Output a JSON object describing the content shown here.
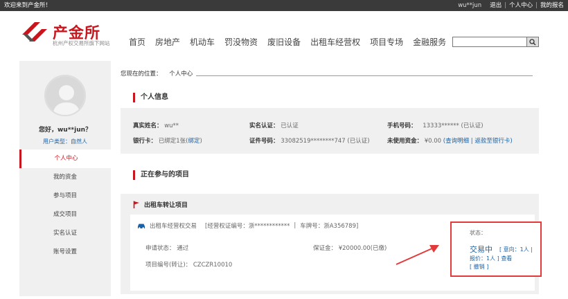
{
  "topbar": {
    "welcome": "欢迎来到产金所！",
    "user": "wu**jun",
    "logout": "退出",
    "center": "个人中心",
    "report": "我的报名"
  },
  "brand": {
    "name": "产金所",
    "sub": "杭州产权交易所旗下网站",
    "color": "#c7161d"
  },
  "nav": [
    "首页",
    "房地产",
    "机动车",
    "罚没物资",
    "废旧设备",
    "出租车经营权",
    "项目专场",
    "金融服务"
  ],
  "search": {
    "placeholder": ""
  },
  "sidebar": {
    "hello": "您好，wu**jun？",
    "user_type": "用户类型：自然人",
    "items": [
      {
        "label": "个人中心",
        "active": true
      },
      {
        "label": "我的资金"
      },
      {
        "label": "参与项目"
      },
      {
        "label": "成交项目"
      },
      {
        "label": "实名认证"
      },
      {
        "label": "账号设置"
      }
    ]
  },
  "breadcrumb": {
    "label": "您现在的位置：",
    "current": "个人中心"
  },
  "personal": {
    "title": "个人信息",
    "name_label": "真实姓名：",
    "name_value": "wu**",
    "verify_label": "实名认证：",
    "verify_value": "已认证",
    "phone_label": "手机号码：",
    "phone_value": "13333******",
    "phone_status": "(已认证)",
    "card_label": "银行卡：",
    "card_value": "已绑定1张(",
    "card_link": "绑定",
    "card_end": ")",
    "id_label": "证件号码：",
    "id_value": "33082519********747",
    "id_status": "(已认证)",
    "funds_label": "未使用资金：",
    "funds_value": "¥0.00",
    "funds_link1": "查询明细",
    "funds_link2": "返款至银行卡"
  },
  "projects": {
    "title": "正在参与的项目",
    "category": "出租车转让项目",
    "item": {
      "name": "出租车经营权交易",
      "permit": "[经营权证编号：浙************",
      "plate": "车牌号：浙A356789]",
      "apply_label": "申请状态：",
      "apply_value": "通过",
      "deposit_label": "保证金：",
      "deposit_value": "¥20000.00(已缴)",
      "code_label": "项目编号(转让)：",
      "code_value": "CZCZR10010",
      "status_label": "状态：",
      "status_value": "交易中",
      "intent": "[ 意向：1人 |",
      "quote": "报价：1人 ]",
      "view": "查看",
      "revoke": "[ 撤销 ]"
    }
  }
}
